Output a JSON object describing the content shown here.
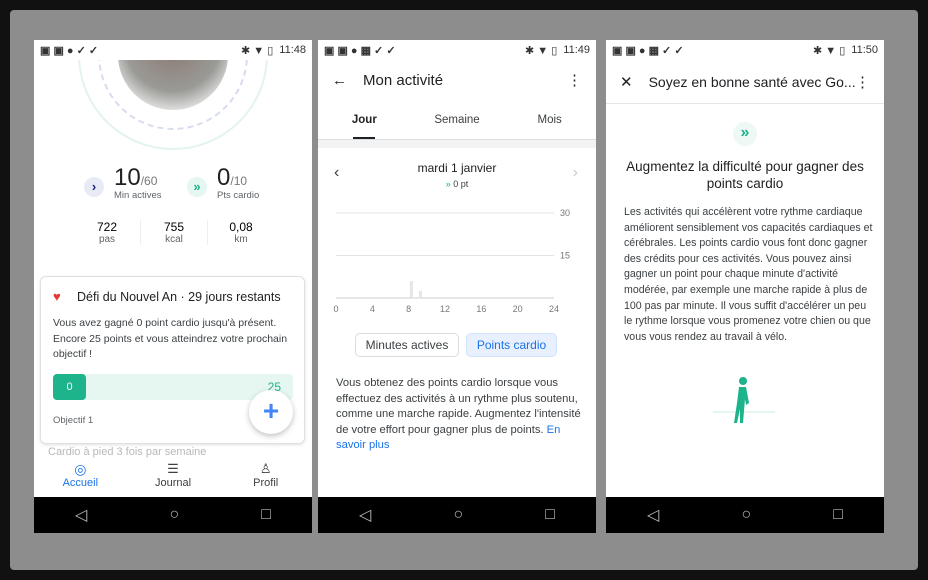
{
  "colors": {
    "accent": "#1a73e8",
    "cardio": "#1db38b",
    "progress_bg": "#e6f7f1"
  },
  "screens": [
    {
      "status": {
        "time": "11:48"
      },
      "goals": {
        "active_value": "10",
        "active_target": "/60",
        "active_label": "Min actives",
        "cardio_value": "0",
        "cardio_target": "/10",
        "cardio_label": "Pts cardio"
      },
      "stats": [
        {
          "value": "722",
          "unit": "pas"
        },
        {
          "value": "755",
          "unit": "kcal"
        },
        {
          "value": "0,08",
          "unit": "km"
        }
      ],
      "challenge": {
        "title": "Défi du Nouvel An · 29 jours restants",
        "text": "Vous avez gagné 0 point cardio jusqu'à présent. Encore 25 points et vous atteindrez votre prochain objectif !",
        "progress_current": "0",
        "progress_target": "25",
        "progress_fraction": 0,
        "objective": "Objectif 1"
      },
      "hidden_text": "Cardio à pied 3 fois par semaine",
      "nav": [
        {
          "label": "Accueil",
          "icon": "home-ring-icon",
          "active": true
        },
        {
          "label": "Journal",
          "icon": "clipboard-icon"
        },
        {
          "label": "Profil",
          "icon": "person-icon"
        }
      ]
    },
    {
      "status": {
        "time": "11:49"
      },
      "title": "Mon activité",
      "tabs": [
        "Jour",
        "Semaine",
        "Mois"
      ],
      "date": "mardi 1 janvier",
      "points": "0 pt",
      "toggle": [
        "Minutes actives",
        "Points cardio"
      ],
      "text": "Vous obtenez des points cardio lorsque vous effectuez des activités à un rythme plus soutenu, comme une marche rapide. Augmentez l'intensité de votre effort pour gagner plus de points.",
      "link": "En savoir plus"
    },
    {
      "status": {
        "time": "11:50"
      },
      "title": "Soyez en bonne santé avec Go...",
      "heading": "Augmentez la difficulté pour gagner des points cardio",
      "text": "Les activités qui accélèrent votre rythme cardiaque améliorent sensiblement vos capacités cardiaques et cérébrales. Les points cardio vous font donc gagner des crédits pour ces activités. Vous pouvez ainsi gagner un point pour chaque minute d'activité modérée, par exemple une marche rapide à plus de 100 pas par minute. Il vous suffit d'accélérer un peu le rythme lorsque vous promenez votre chien ou que vous vous rendez au travail à vélo."
    }
  ],
  "chart_data": {
    "type": "bar",
    "x": [
      8.3,
      9.3
    ],
    "values": [
      6,
      2.5
    ],
    "xlim": [
      0,
      24
    ],
    "ylim": [
      0,
      30
    ],
    "xticks": [
      "0",
      "4",
      "8",
      "12",
      "16",
      "20",
      "24"
    ],
    "yticks": [
      "15",
      "30"
    ],
    "grid": true
  }
}
